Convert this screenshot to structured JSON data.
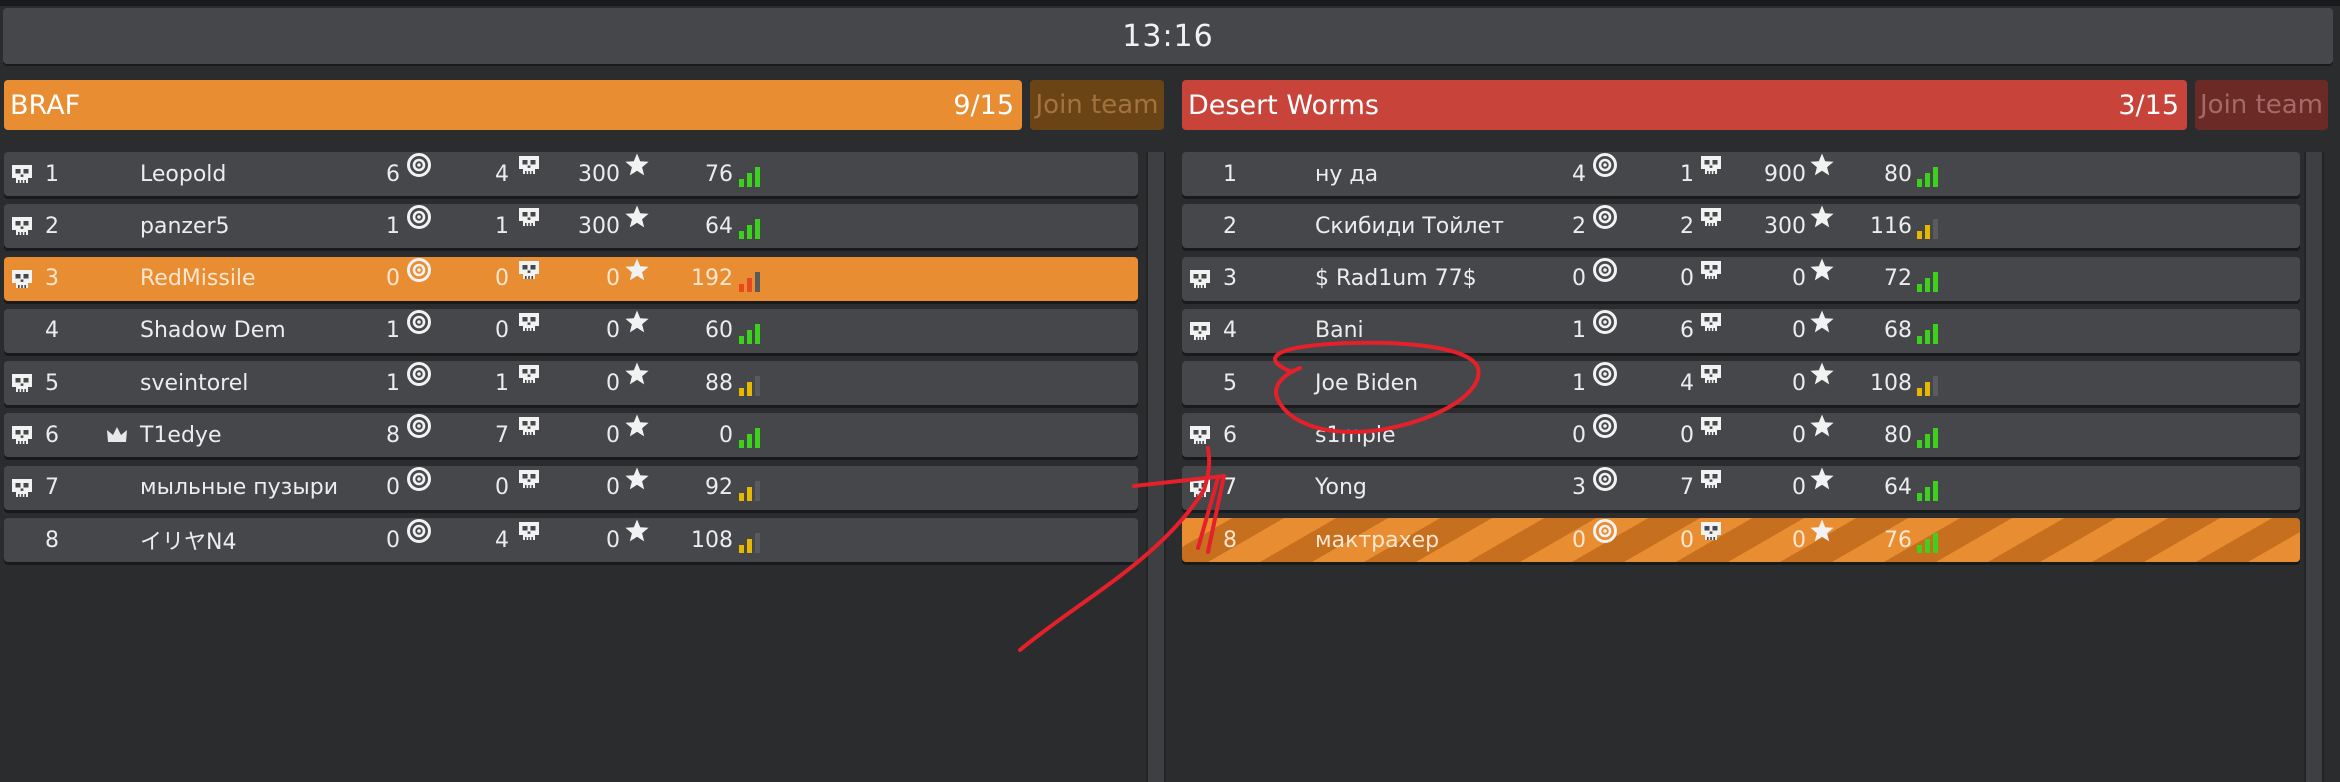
{
  "timer": "13:16",
  "colors": {
    "team_left": "#e88d32",
    "team_right": "#c8443b",
    "signal_green": "#3bd11c",
    "signal_yellow": "#e6b800",
    "signal_red": "#e8481f",
    "annotation": "#e5202a"
  },
  "teams": [
    {
      "name": "BRAF",
      "count": "9/15",
      "join_label": "Join team",
      "players": [
        {
          "rank": "1",
          "name": "Leopold",
          "kills": "6",
          "deaths": "4",
          "score": "300",
          "ping": "76",
          "skull": true,
          "crown": false,
          "signal": "green",
          "highlight": ""
        },
        {
          "rank": "2",
          "name": "panzer5",
          "kills": "1",
          "deaths": "1",
          "score": "300",
          "ping": "64",
          "skull": true,
          "crown": false,
          "signal": "green",
          "highlight": ""
        },
        {
          "rank": "3",
          "name": "RedMissile",
          "kills": "0",
          "deaths": "0",
          "score": "0",
          "ping": "192",
          "skull": true,
          "crown": false,
          "signal": "red",
          "highlight": "solid"
        },
        {
          "rank": "4",
          "name": "Shadow Dem",
          "kills": "1",
          "deaths": "0",
          "score": "0",
          "ping": "60",
          "skull": false,
          "crown": false,
          "signal": "green",
          "highlight": ""
        },
        {
          "rank": "5",
          "name": "sveintorel",
          "kills": "1",
          "deaths": "1",
          "score": "0",
          "ping": "88",
          "skull": true,
          "crown": false,
          "signal": "yellow",
          "highlight": ""
        },
        {
          "rank": "6",
          "name": "T1edye",
          "kills": "8",
          "deaths": "7",
          "score": "0",
          "ping": "0",
          "skull": true,
          "crown": true,
          "signal": "green",
          "highlight": ""
        },
        {
          "rank": "7",
          "name": "мыльные пузыри",
          "kills": "0",
          "deaths": "0",
          "score": "0",
          "ping": "92",
          "skull": true,
          "crown": false,
          "signal": "yellow",
          "highlight": ""
        },
        {
          "rank": "8",
          "name": "イリヤN4",
          "kills": "0",
          "deaths": "4",
          "score": "0",
          "ping": "108",
          "skull": false,
          "crown": false,
          "signal": "yellow",
          "highlight": ""
        }
      ]
    },
    {
      "name": "Desert Worms",
      "count": "3/15",
      "join_label": "Join team",
      "players": [
        {
          "rank": "1",
          "name": "ну да",
          "kills": "4",
          "deaths": "1",
          "score": "900",
          "ping": "80",
          "skull": false,
          "crown": false,
          "signal": "green",
          "highlight": ""
        },
        {
          "rank": "2",
          "name": "Скибиди Тойлет",
          "kills": "2",
          "deaths": "2",
          "score": "300",
          "ping": "116",
          "skull": false,
          "crown": false,
          "signal": "yellow",
          "highlight": ""
        },
        {
          "rank": "3",
          "name": "$ Rad1um 77$",
          "kills": "0",
          "deaths": "0",
          "score": "0",
          "ping": "72",
          "skull": true,
          "crown": false,
          "signal": "green",
          "highlight": ""
        },
        {
          "rank": "4",
          "name": "Bani",
          "kills": "1",
          "deaths": "6",
          "score": "0",
          "ping": "68",
          "skull": true,
          "crown": false,
          "signal": "green",
          "highlight": ""
        },
        {
          "rank": "5",
          "name": "Joe Biden",
          "kills": "1",
          "deaths": "4",
          "score": "0",
          "ping": "108",
          "skull": false,
          "crown": false,
          "signal": "yellow",
          "highlight": ""
        },
        {
          "rank": "6",
          "name": "s1mple",
          "kills": "0",
          "deaths": "0",
          "score": "0",
          "ping": "80",
          "skull": true,
          "crown": false,
          "signal": "green",
          "highlight": ""
        },
        {
          "rank": "7",
          "name": "Yong",
          "kills": "3",
          "deaths": "7",
          "score": "0",
          "ping": "64",
          "skull": true,
          "crown": false,
          "signal": "green",
          "highlight": ""
        },
        {
          "rank": "8",
          "name": "мактрахер",
          "kills": "0",
          "deaths": "0",
          "score": "0",
          "ping": "76",
          "skull": false,
          "crown": false,
          "signal": "green",
          "highlight": "striped"
        }
      ]
    }
  ]
}
